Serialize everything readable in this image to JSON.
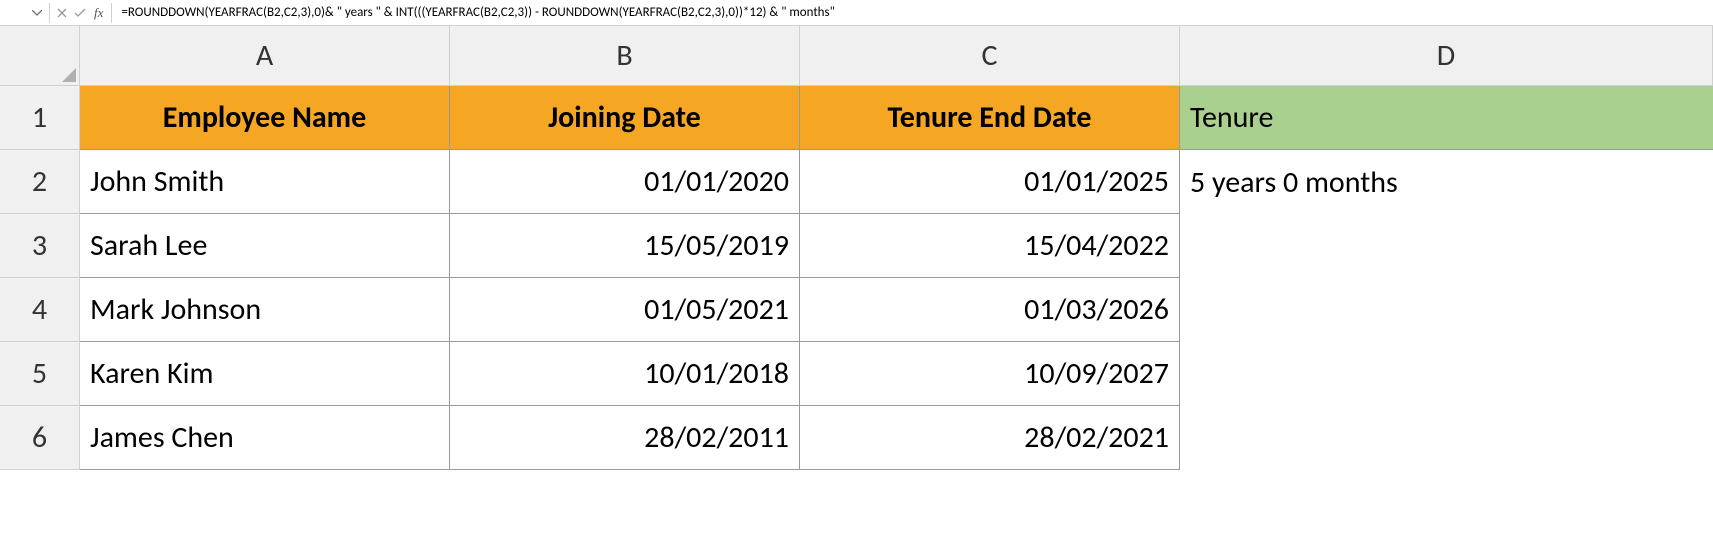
{
  "formula_bar": {
    "fx_label": "fx",
    "formula": "=ROUNDDOWN(YEARFRAC(B2,C2,3),0)& \" years \" & INT(((YEARFRAC(B2,C2,3)) - ROUNDDOWN(YEARFRAC(B2,C2,3),0))*12) & \" months\""
  },
  "columns": [
    "A",
    "B",
    "C",
    "D"
  ],
  "row_numbers": [
    "1",
    "2",
    "3",
    "4",
    "5",
    "6"
  ],
  "headers": {
    "A": "Employee Name",
    "B": "Joining Date",
    "C": "Tenure End Date",
    "D": "Tenure"
  },
  "rows": [
    {
      "name": "John Smith",
      "joining": "01/01/2020",
      "end": "01/01/2025",
      "tenure": "5 years 0 months"
    },
    {
      "name": "Sarah Lee",
      "joining": "15/05/2019",
      "end": "15/04/2022",
      "tenure": ""
    },
    {
      "name": "Mark Johnson",
      "joining": "01/05/2021",
      "end": "01/03/2026",
      "tenure": ""
    },
    {
      "name": "Karen Kim",
      "joining": "10/01/2018",
      "end": "10/09/2027",
      "tenure": ""
    },
    {
      "name": "James Chen",
      "joining": "28/02/2011",
      "end": "28/02/2021",
      "tenure": ""
    }
  ]
}
